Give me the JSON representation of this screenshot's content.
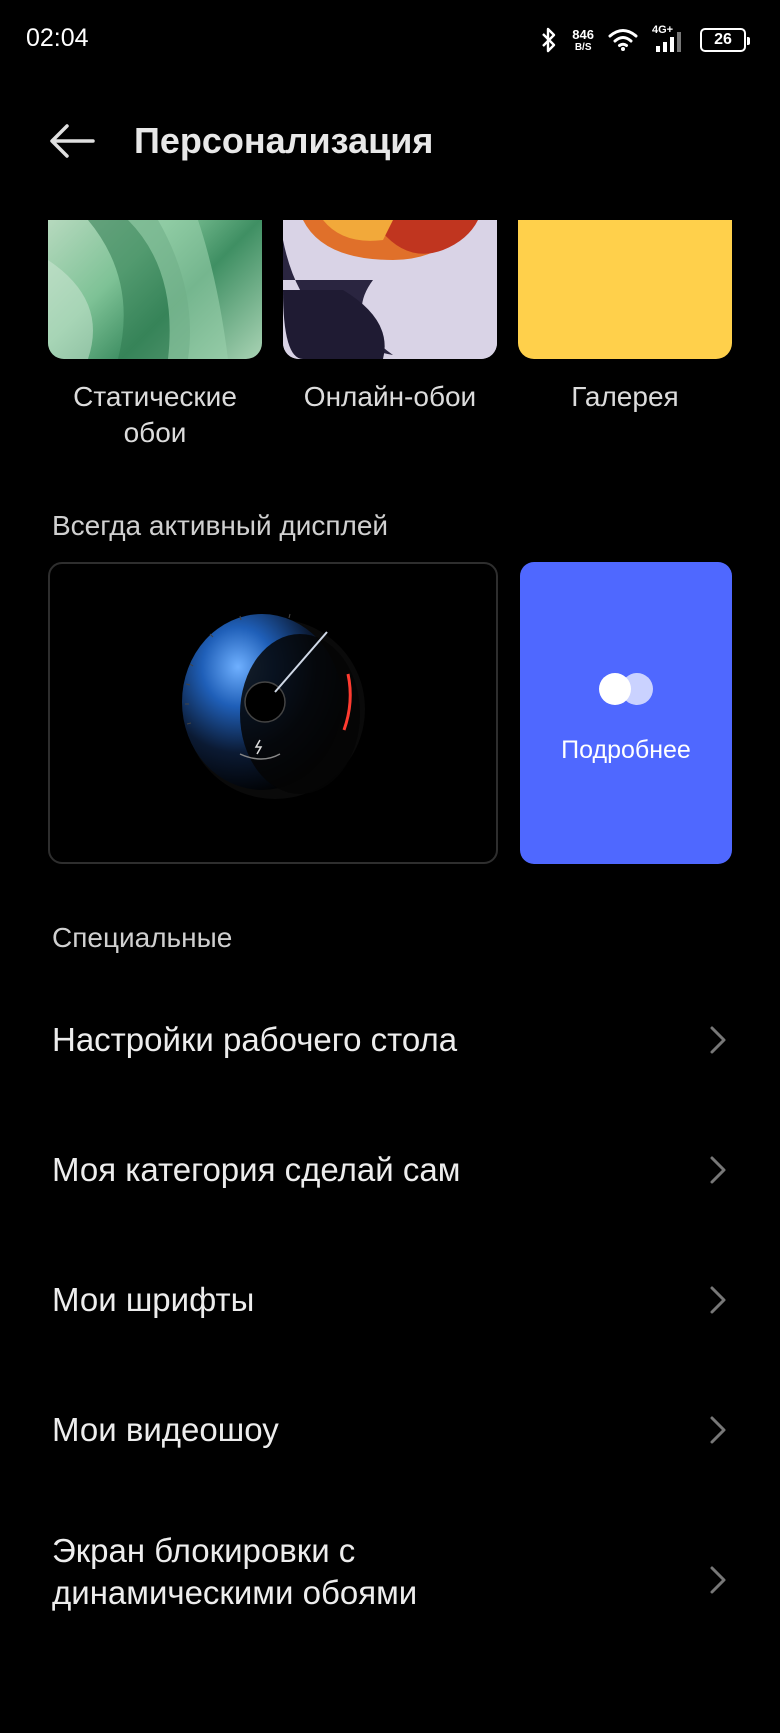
{
  "status_bar": {
    "time": "02:04",
    "net_speed_value": "846",
    "net_speed_unit": "B/S",
    "network": "4G+",
    "battery": "26",
    "icons": [
      "bluetooth-icon",
      "wifi-icon",
      "signal-icon",
      "battery-icon"
    ]
  },
  "header": {
    "title": "Персонализация",
    "back_icon": "arrow-left-icon"
  },
  "wallpapers": [
    {
      "label": "Статические обои"
    },
    {
      "label": "Онлайн-обои"
    },
    {
      "label": "Галерея"
    }
  ],
  "aod": {
    "section_label": "Всегда активный дисплей",
    "more_label": "Подробнее"
  },
  "special": {
    "section_label": "Специальные",
    "items": [
      {
        "label": "Настройки рабочего стола"
      },
      {
        "label": "Моя категория сделай сам"
      },
      {
        "label": "Мои шрифты"
      },
      {
        "label": "Мои видеошоу"
      },
      {
        "label": "Экран блокировки с динамическими обоями"
      }
    ]
  },
  "colors": {
    "background": "#000000",
    "accent_card": "#4f68ff",
    "gallery": "#ffd04b"
  }
}
